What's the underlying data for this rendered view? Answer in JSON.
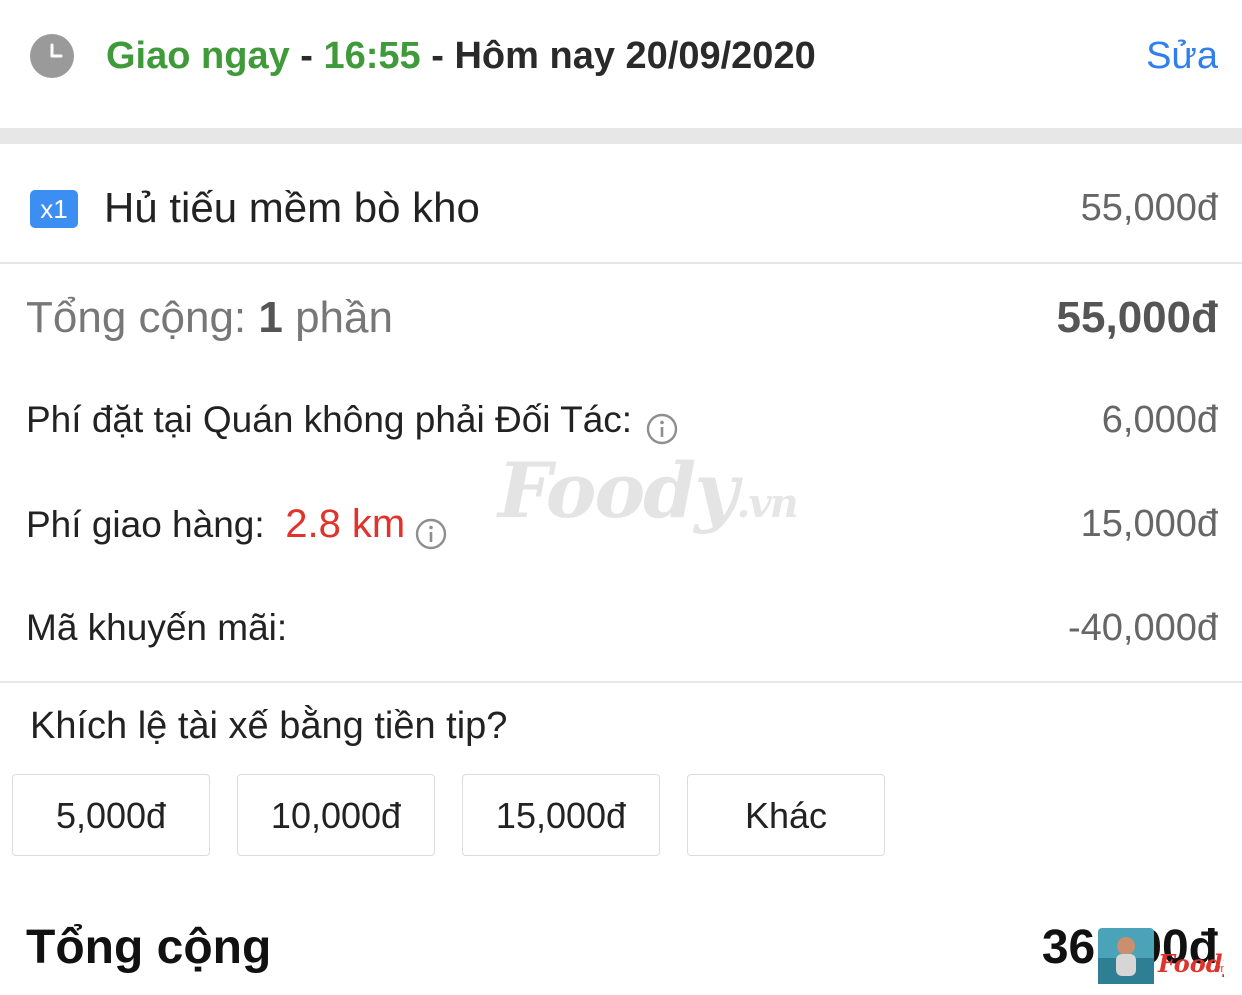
{
  "header": {
    "delivery_mode": "Giao ngay",
    "sep1": " - ",
    "time": "16:55",
    "sep2": " - ",
    "date": "Hôm nay 20/09/2020",
    "edit_label": "Sửa",
    "icon": "clock-icon"
  },
  "order": {
    "items": [
      {
        "qty": "x1",
        "name": "Hủ tiếu mềm bò kho",
        "price": "55,000đ"
      }
    ]
  },
  "summary": {
    "subtotal_prefix": "Tổng cộng: ",
    "subtotal_count": "1",
    "subtotal_suffix": " phần",
    "subtotal_value": "55,000đ",
    "partner_fee_label": "Phí đặt tại Quán không phải Đối Tác:",
    "partner_fee_value": "6,000đ",
    "delivery_fee_label": "Phí giao hàng:",
    "delivery_distance": "2.8 km",
    "delivery_fee_value": "15,000đ",
    "promo_label": "Mã khuyến mãi:",
    "promo_value": "-40,000đ",
    "info_icon": "info-icon"
  },
  "tip": {
    "question": "Khích lệ tài xế bằng tiền tip?",
    "options": [
      "5,000đ",
      "10,000đ",
      "15,000đ",
      "Khác"
    ]
  },
  "total": {
    "label": "Tổng cộng",
    "value": "36,000đ"
  },
  "watermark": {
    "brand": "Foody",
    "suffix": ".vn"
  },
  "colors": {
    "green": "#3f9a3a",
    "link_blue": "#2f80ed",
    "badge_blue": "#3d8ef2",
    "distance_red": "#e0332b"
  }
}
